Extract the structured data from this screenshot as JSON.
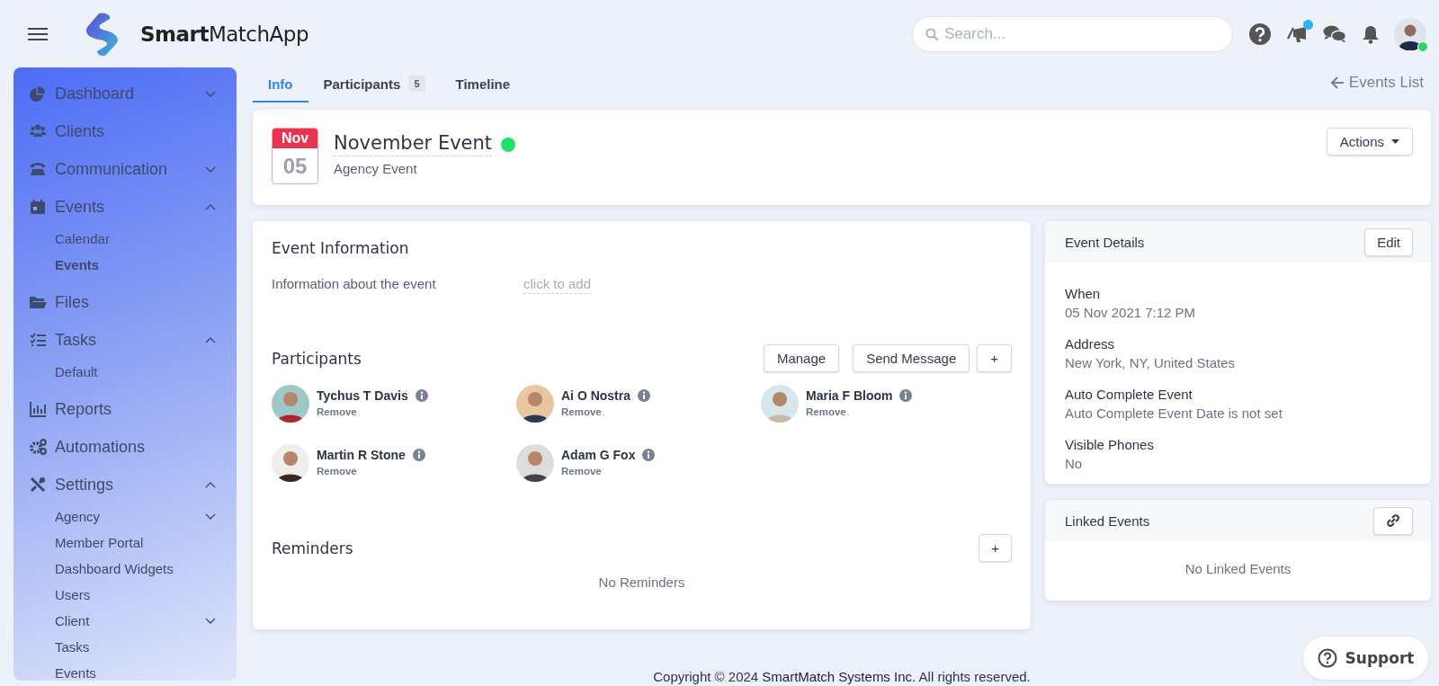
{
  "header": {
    "app_name": "**Smart**MatchApp",
    "search": {
      "placeholder": "Search..."
    },
    "icons": [
      {
        "kind": "help",
        "badge": false
      },
      {
        "kind": "megaphone",
        "badge": true
      },
      {
        "kind": "chat",
        "badge": false
      },
      {
        "kind": "bell",
        "badge": false
      }
    ],
    "user": {
      "online": true
    }
  },
  "sidebar": {
    "items": [
      {
        "label": "Dashboard",
        "kind": "group",
        "expanded": false,
        "selected": false
      },
      {
        "label": "Clients",
        "kind": "link",
        "selected": false
      },
      {
        "label": "Communication",
        "kind": "group",
        "expanded": false,
        "selected": false
      },
      {
        "label": "Events",
        "kind": "group",
        "expanded": true,
        "selected": false,
        "children": [
          {
            "label": "Calendar",
            "kind": "link",
            "selected": false
          },
          {
            "label": "Events",
            "kind": "link",
            "selected": true
          }
        ]
      },
      {
        "label": "Files",
        "kind": "link",
        "selected": false
      },
      {
        "label": "Tasks",
        "kind": "group",
        "expanded": true,
        "selected": false,
        "children": [
          {
            "label": "Default",
            "kind": "link",
            "selected": false
          }
        ]
      },
      {
        "label": "Reports",
        "kind": "link",
        "selected": false
      },
      {
        "label": "Automations",
        "kind": "link",
        "selected": false
      },
      {
        "label": "Settings",
        "kind": "group",
        "expanded": true,
        "selected": false,
        "children": [
          {
            "label": "Agency",
            "kind": "group",
            "expanded": false,
            "selected": false
          },
          {
            "label": "Member Portal",
            "kind": "link",
            "selected": false
          },
          {
            "label": "Dashboard Widgets",
            "kind": "link",
            "selected": false
          },
          {
            "label": "Users",
            "kind": "link",
            "selected": false
          },
          {
            "label": "Client",
            "kind": "group",
            "expanded": false,
            "selected": false
          },
          {
            "label": "Tasks",
            "kind": "link",
            "selected": false
          },
          {
            "label": "Events",
            "kind": "link",
            "selected": false
          }
        ]
      }
    ]
  },
  "tabs": [
    {
      "label": "Info",
      "selected": true
    },
    {
      "label": "Participants",
      "count": "5",
      "selected": false
    },
    {
      "label": "Timeline",
      "selected": false
    }
  ],
  "back_link": "Events List",
  "event": {
    "month": "Nov",
    "day": "05",
    "title": "November Event",
    "active": true,
    "subtitle": "Agency Event",
    "actions_button": "Actions"
  },
  "event_information": {
    "title": "Event Information",
    "label": "Information about the event",
    "value_hint": "click to add"
  },
  "participants": {
    "title": "Participants",
    "buttons": [
      "Manage",
      "Send Message",
      "+"
    ],
    "people": [
      {
        "name": "Tychus T Davis",
        "action": "Remove"
      },
      {
        "name": "Ai O Nostra",
        "action": "Remove"
      },
      {
        "name": "Maria F Bloom",
        "action": "Remove"
      },
      {
        "name": "Martin R Stone",
        "action": "Remove"
      },
      {
        "name": "Adam G Fox",
        "action": "Remove"
      }
    ]
  },
  "reminders": {
    "title": "Reminders",
    "add_button": "+",
    "empty_text": "No Reminders"
  },
  "event_details": {
    "title": "Event Details",
    "edit_button": "Edit",
    "fields": [
      {
        "label": "When",
        "value": "05 Nov 2021 7:12 PM"
      },
      {
        "label": "Address",
        "value": "New York, NY, United States"
      },
      {
        "label": "Auto Complete Event",
        "value": "Auto Complete Event Date is not set"
      },
      {
        "label": "Visible Phones",
        "value": "No"
      }
    ]
  },
  "linked_events": {
    "title": "Linked Events",
    "empty_text": "No Linked Events"
  },
  "footer": {
    "text_before": "Copyright © 2024",
    "link": "SmartMatch Systems Inc.",
    "text_after": "All rights reserved."
  },
  "support_button": "Support"
}
